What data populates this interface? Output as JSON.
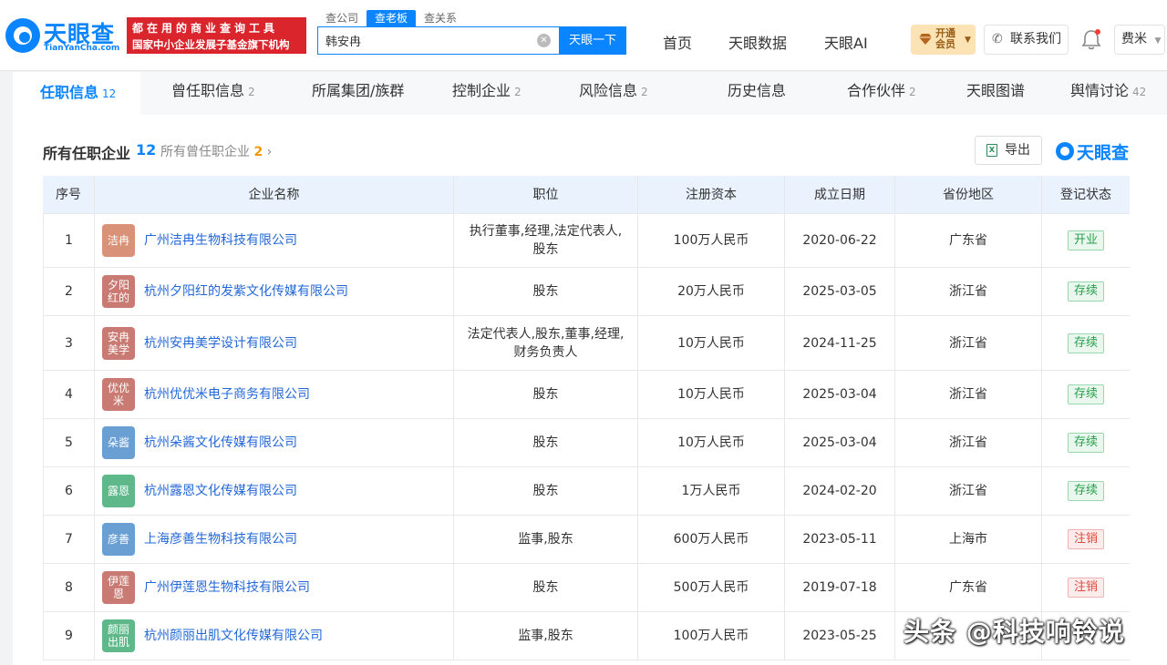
{
  "header": {
    "logo_name": "天眼查",
    "logo_domain": "TianYanCha.com",
    "slogan_line1": "都在用的商业查询工具",
    "slogan_line2": "国家中小企业发展子基金旗下机构",
    "search_tabs": [
      "查公司",
      "查老板",
      "查关系"
    ],
    "search_value": "韩安冉",
    "search_button": "天眼一下",
    "nav": [
      "首页",
      "天眼数据",
      "天眼AI"
    ],
    "vip_line1": "开通",
    "vip_line2": "会员",
    "contact": "联系我们",
    "user": "费米"
  },
  "tabs": [
    {
      "label": "任职信息",
      "count": "12"
    },
    {
      "label": "曾任职信息",
      "count": "2"
    },
    {
      "label": "所属集团/族群",
      "count": ""
    },
    {
      "label": "控制企业",
      "count": "2"
    },
    {
      "label": "风险信息",
      "count": "2"
    },
    {
      "label": "历史信息",
      "count": ""
    },
    {
      "label": "合作伙伴",
      "count": "2"
    },
    {
      "label": "天眼图谱",
      "count": ""
    },
    {
      "label": "舆情讨论",
      "count": "42"
    }
  ],
  "section": {
    "title": "所有任职企业",
    "count": "12",
    "link_text": "所有曾任职企业",
    "link_count": "2",
    "export_label": "导出",
    "excel_glyph": "X",
    "brand": "天眼查"
  },
  "table": {
    "headers": [
      "序号",
      "企业名称",
      "职位",
      "注册资本",
      "成立日期",
      "省份地区",
      "登记状态"
    ],
    "rows": [
      {
        "no": "1",
        "avatar": "洁冉",
        "avatar_color": "#d99178",
        "name": "广州洁冉生物科技有限公司",
        "position": "执行董事,经理,法定代表人,股东",
        "capital": "100万人民币",
        "date": "2020-06-22",
        "region": "广东省",
        "status": "开业",
        "status_type": "green"
      },
      {
        "no": "2",
        "avatar": "夕阳红的",
        "avatar_color": "#c97a72",
        "name": "杭州夕阳红的发紫文化传媒有限公司",
        "position": "股东",
        "capital": "20万人民币",
        "date": "2025-03-05",
        "region": "浙江省",
        "status": "存续",
        "status_type": "green"
      },
      {
        "no": "3",
        "avatar": "安冉美学",
        "avatar_color": "#c97a72",
        "name": "杭州安冉美学设计有限公司",
        "position": "法定代表人,股东,董事,经理,财务负责人",
        "capital": "10万人民币",
        "date": "2024-11-25",
        "region": "浙江省",
        "status": "存续",
        "status_type": "green"
      },
      {
        "no": "4",
        "avatar": "优优米",
        "avatar_color": "#c97a72",
        "name": "杭州优优米电子商务有限公司",
        "position": "股东",
        "capital": "10万人民币",
        "date": "2025-03-04",
        "region": "浙江省",
        "status": "存续",
        "status_type": "green"
      },
      {
        "no": "5",
        "avatar": "朵酱",
        "avatar_color": "#6a9fd3",
        "name": "杭州朵酱文化传媒有限公司",
        "position": "股东",
        "capital": "10万人民币",
        "date": "2025-03-04",
        "region": "浙江省",
        "status": "存续",
        "status_type": "green"
      },
      {
        "no": "6",
        "avatar": "露恩",
        "avatar_color": "#5fb88a",
        "name": "杭州露恩文化传媒有限公司",
        "position": "股东",
        "capital": "1万人民币",
        "date": "2024-02-20",
        "region": "浙江省",
        "status": "存续",
        "status_type": "green"
      },
      {
        "no": "7",
        "avatar": "彦善",
        "avatar_color": "#6a9fd3",
        "name": "上海彦善生物科技有限公司",
        "position": "监事,股东",
        "capital": "600万人民币",
        "date": "2023-05-11",
        "region": "上海市",
        "status": "注销",
        "status_type": "red"
      },
      {
        "no": "8",
        "avatar": "伊莲恩",
        "avatar_color": "#c97a72",
        "name": "广州伊莲恩生物科技有限公司",
        "position": "股东",
        "capital": "500万人民币",
        "date": "2019-07-18",
        "region": "广东省",
        "status": "注销",
        "status_type": "red"
      },
      {
        "no": "9",
        "avatar": "颜丽出肌",
        "avatar_color": "#5fb88a",
        "name": "杭州颜丽出肌文化传媒有限公司",
        "position": "监事,股东",
        "capital": "100万人民币",
        "date": "2023-05-25",
        "region": "",
        "status": "",
        "status_type": "none"
      }
    ]
  },
  "watermark": "头条 @科技响铃说",
  "colors": {
    "accent": "#0a84ff",
    "slogan_bg": "#d9252b",
    "link": "#2468d8",
    "header_row": "#eaf2fd"
  }
}
